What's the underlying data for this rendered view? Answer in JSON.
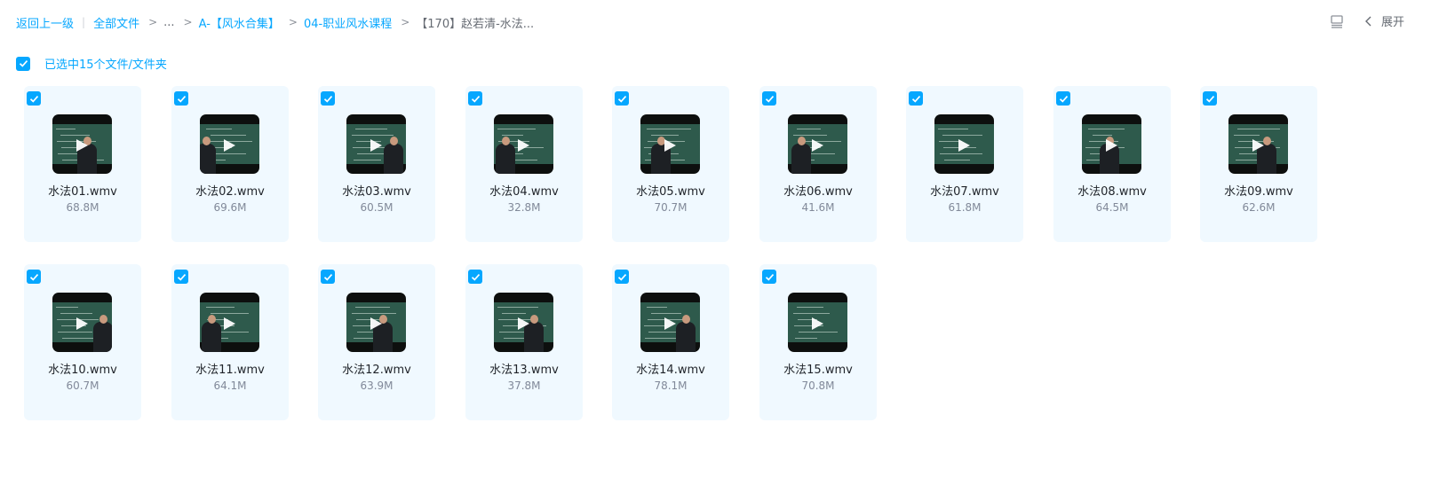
{
  "breadcrumb": {
    "back": "返回上一级",
    "all_files": "全部文件",
    "ellipsis": "...",
    "folder1": "A-【风水合集】",
    "folder2": "04-职业风水课程",
    "current": "【170】赵若清-水法..."
  },
  "toolbar": {
    "expand_label": "展开"
  },
  "selection": {
    "text": "已选中15个文件/文件夹"
  },
  "colors": {
    "accent": "#06a7ff",
    "card_bg": "#f0f9ff"
  },
  "files": [
    {
      "name": "水法01.wmv",
      "size": "68.8M",
      "checked": true
    },
    {
      "name": "水法02.wmv",
      "size": "69.6M",
      "checked": true
    },
    {
      "name": "水法03.wmv",
      "size": "60.5M",
      "checked": true
    },
    {
      "name": "水法04.wmv",
      "size": "32.8M",
      "checked": true
    },
    {
      "name": "水法05.wmv",
      "size": "70.7M",
      "checked": true
    },
    {
      "name": "水法06.wmv",
      "size": "41.6M",
      "checked": true
    },
    {
      "name": "水法07.wmv",
      "size": "61.8M",
      "checked": true
    },
    {
      "name": "水法08.wmv",
      "size": "64.5M",
      "checked": true
    },
    {
      "name": "水法09.wmv",
      "size": "62.6M",
      "checked": true
    },
    {
      "name": "水法10.wmv",
      "size": "60.7M",
      "checked": true
    },
    {
      "name": "水法11.wmv",
      "size": "64.1M",
      "checked": true
    },
    {
      "name": "水法12.wmv",
      "size": "63.9M",
      "checked": true
    },
    {
      "name": "水法13.wmv",
      "size": "37.8M",
      "checked": true
    },
    {
      "name": "水法14.wmv",
      "size": "78.1M",
      "checked": true
    },
    {
      "name": "水法15.wmv",
      "size": "70.8M",
      "checked": true
    }
  ]
}
